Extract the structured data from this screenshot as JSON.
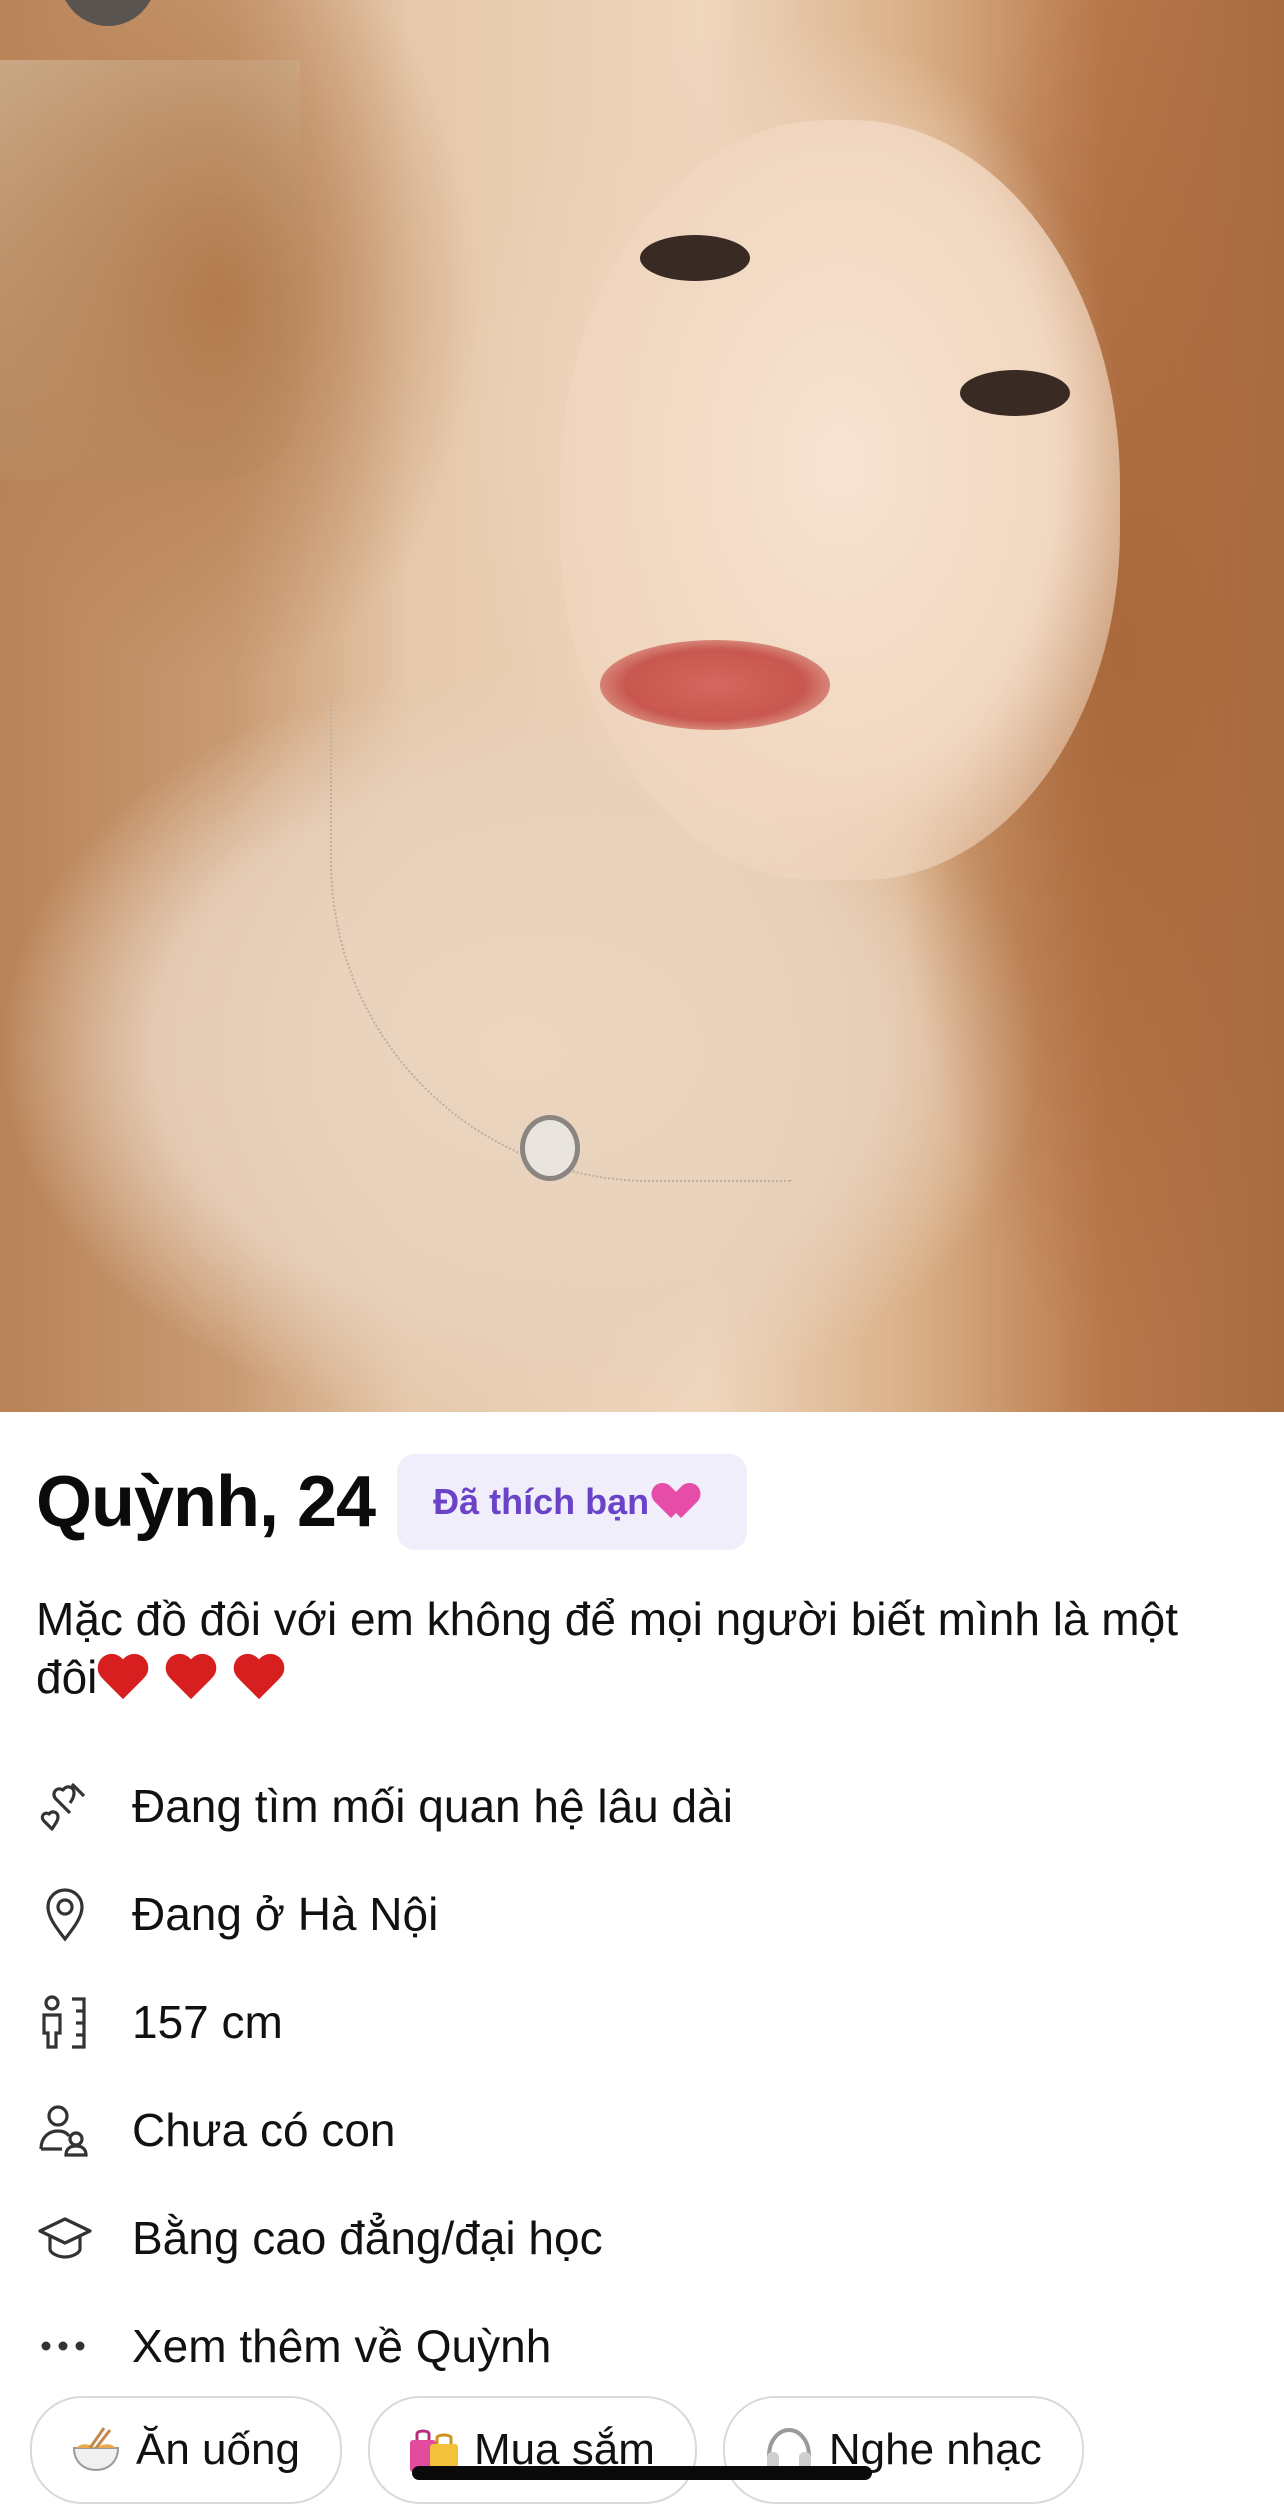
{
  "profile": {
    "name_age": "Quỳnh, 24",
    "liked_badge": "Đã thích bạn",
    "bio": "Mặc đồ đôi với em không để mọi người biết mình là một đôi"
  },
  "details": [
    {
      "icon": "relationship-hearts-icon",
      "text": "Đang tìm mối quan hệ lâu dài"
    },
    {
      "icon": "location-pin-icon",
      "text": "Đang ở Hà Nội"
    },
    {
      "icon": "height-icon",
      "text": "157 cm"
    },
    {
      "icon": "children-icon",
      "text": "Chưa có con"
    },
    {
      "icon": "graduation-cap-icon",
      "text": "Bằng cao đẳng/đại học"
    },
    {
      "icon": "more-dots-icon",
      "text": "Xem thêm về Quỳnh"
    }
  ],
  "interests": [
    {
      "icon": "noodle-bowl-icon",
      "label": "Ăn uống"
    },
    {
      "icon": "shopping-bags-icon",
      "label": "Mua sắm"
    },
    {
      "icon": "headphones-icon",
      "label": "Nghe nhạc"
    }
  ],
  "colors": {
    "badge_bg": "#f1eefb",
    "badge_text": "#6a43c9",
    "badge_heart": "#e64da8",
    "bio_hearts": "#d71f1f"
  }
}
